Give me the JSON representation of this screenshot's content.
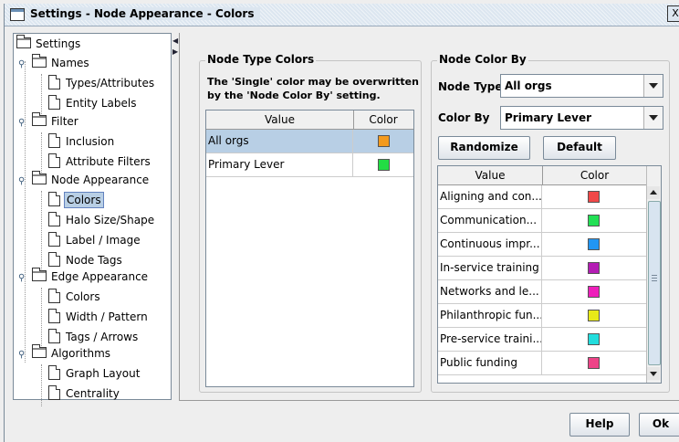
{
  "window": {
    "title": "Settings - Node Appearance - Colors",
    "close_glyph": "X"
  },
  "tree": {
    "root": "Settings",
    "names": "Names",
    "types_attributes": "Types/Attributes",
    "entity_labels": "Entity Labels",
    "filter": "Filter",
    "inclusion": "Inclusion",
    "attribute_filters": "Attribute Filters",
    "node_appearance": "Node Appearance",
    "colors": "Colors",
    "halo": "Halo Size/Shape",
    "label_image": "Label / Image",
    "node_tags": "Node Tags",
    "edge_appearance": "Edge Appearance",
    "edge_colors": "Colors",
    "width_pattern": "Width / Pattern",
    "tags_arrows": "Tags / Arrows",
    "algorithms": "Algorithms",
    "graph_layout": "Graph Layout",
    "centrality": "Centrality",
    "selected": "Colors"
  },
  "node_type_colors": {
    "title": "Node Type Colors",
    "description_line1": "The 'Single' color may be overwritten",
    "description_line2": "by the 'Node Color By' setting.",
    "columns": [
      "Value",
      "Color"
    ],
    "rows": [
      {
        "value": "All orgs",
        "color": "#f39a1e"
      },
      {
        "value": "Primary Lever",
        "color": "#22dd44"
      }
    ]
  },
  "node_color_by": {
    "title": "Node Color By",
    "node_type_label": "Node Type",
    "node_type_value": "All orgs",
    "color_by_label": "Color By",
    "color_by_value": "Primary Lever",
    "randomize_label": "Randomize",
    "default_label": "Default",
    "columns": [
      "Value",
      "Color"
    ],
    "rows": [
      {
        "value": "Aligning and con...",
        "color": "#f04848"
      },
      {
        "value": "Communication...",
        "color": "#22e055"
      },
      {
        "value": "Continuous impr...",
        "color": "#2196f3"
      },
      {
        "value": "In-service training",
        "color": "#b41db4"
      },
      {
        "value": "Networks and le...",
        "color": "#ee1fbb"
      },
      {
        "value": "Philanthropic fun...",
        "color": "#e8ea18"
      },
      {
        "value": "Pre-service traini...",
        "color": "#22dddd"
      },
      {
        "value": "Public funding",
        "color": "#ee4488"
      }
    ]
  },
  "footer": {
    "help_label": "Help",
    "ok_label": "Ok"
  }
}
